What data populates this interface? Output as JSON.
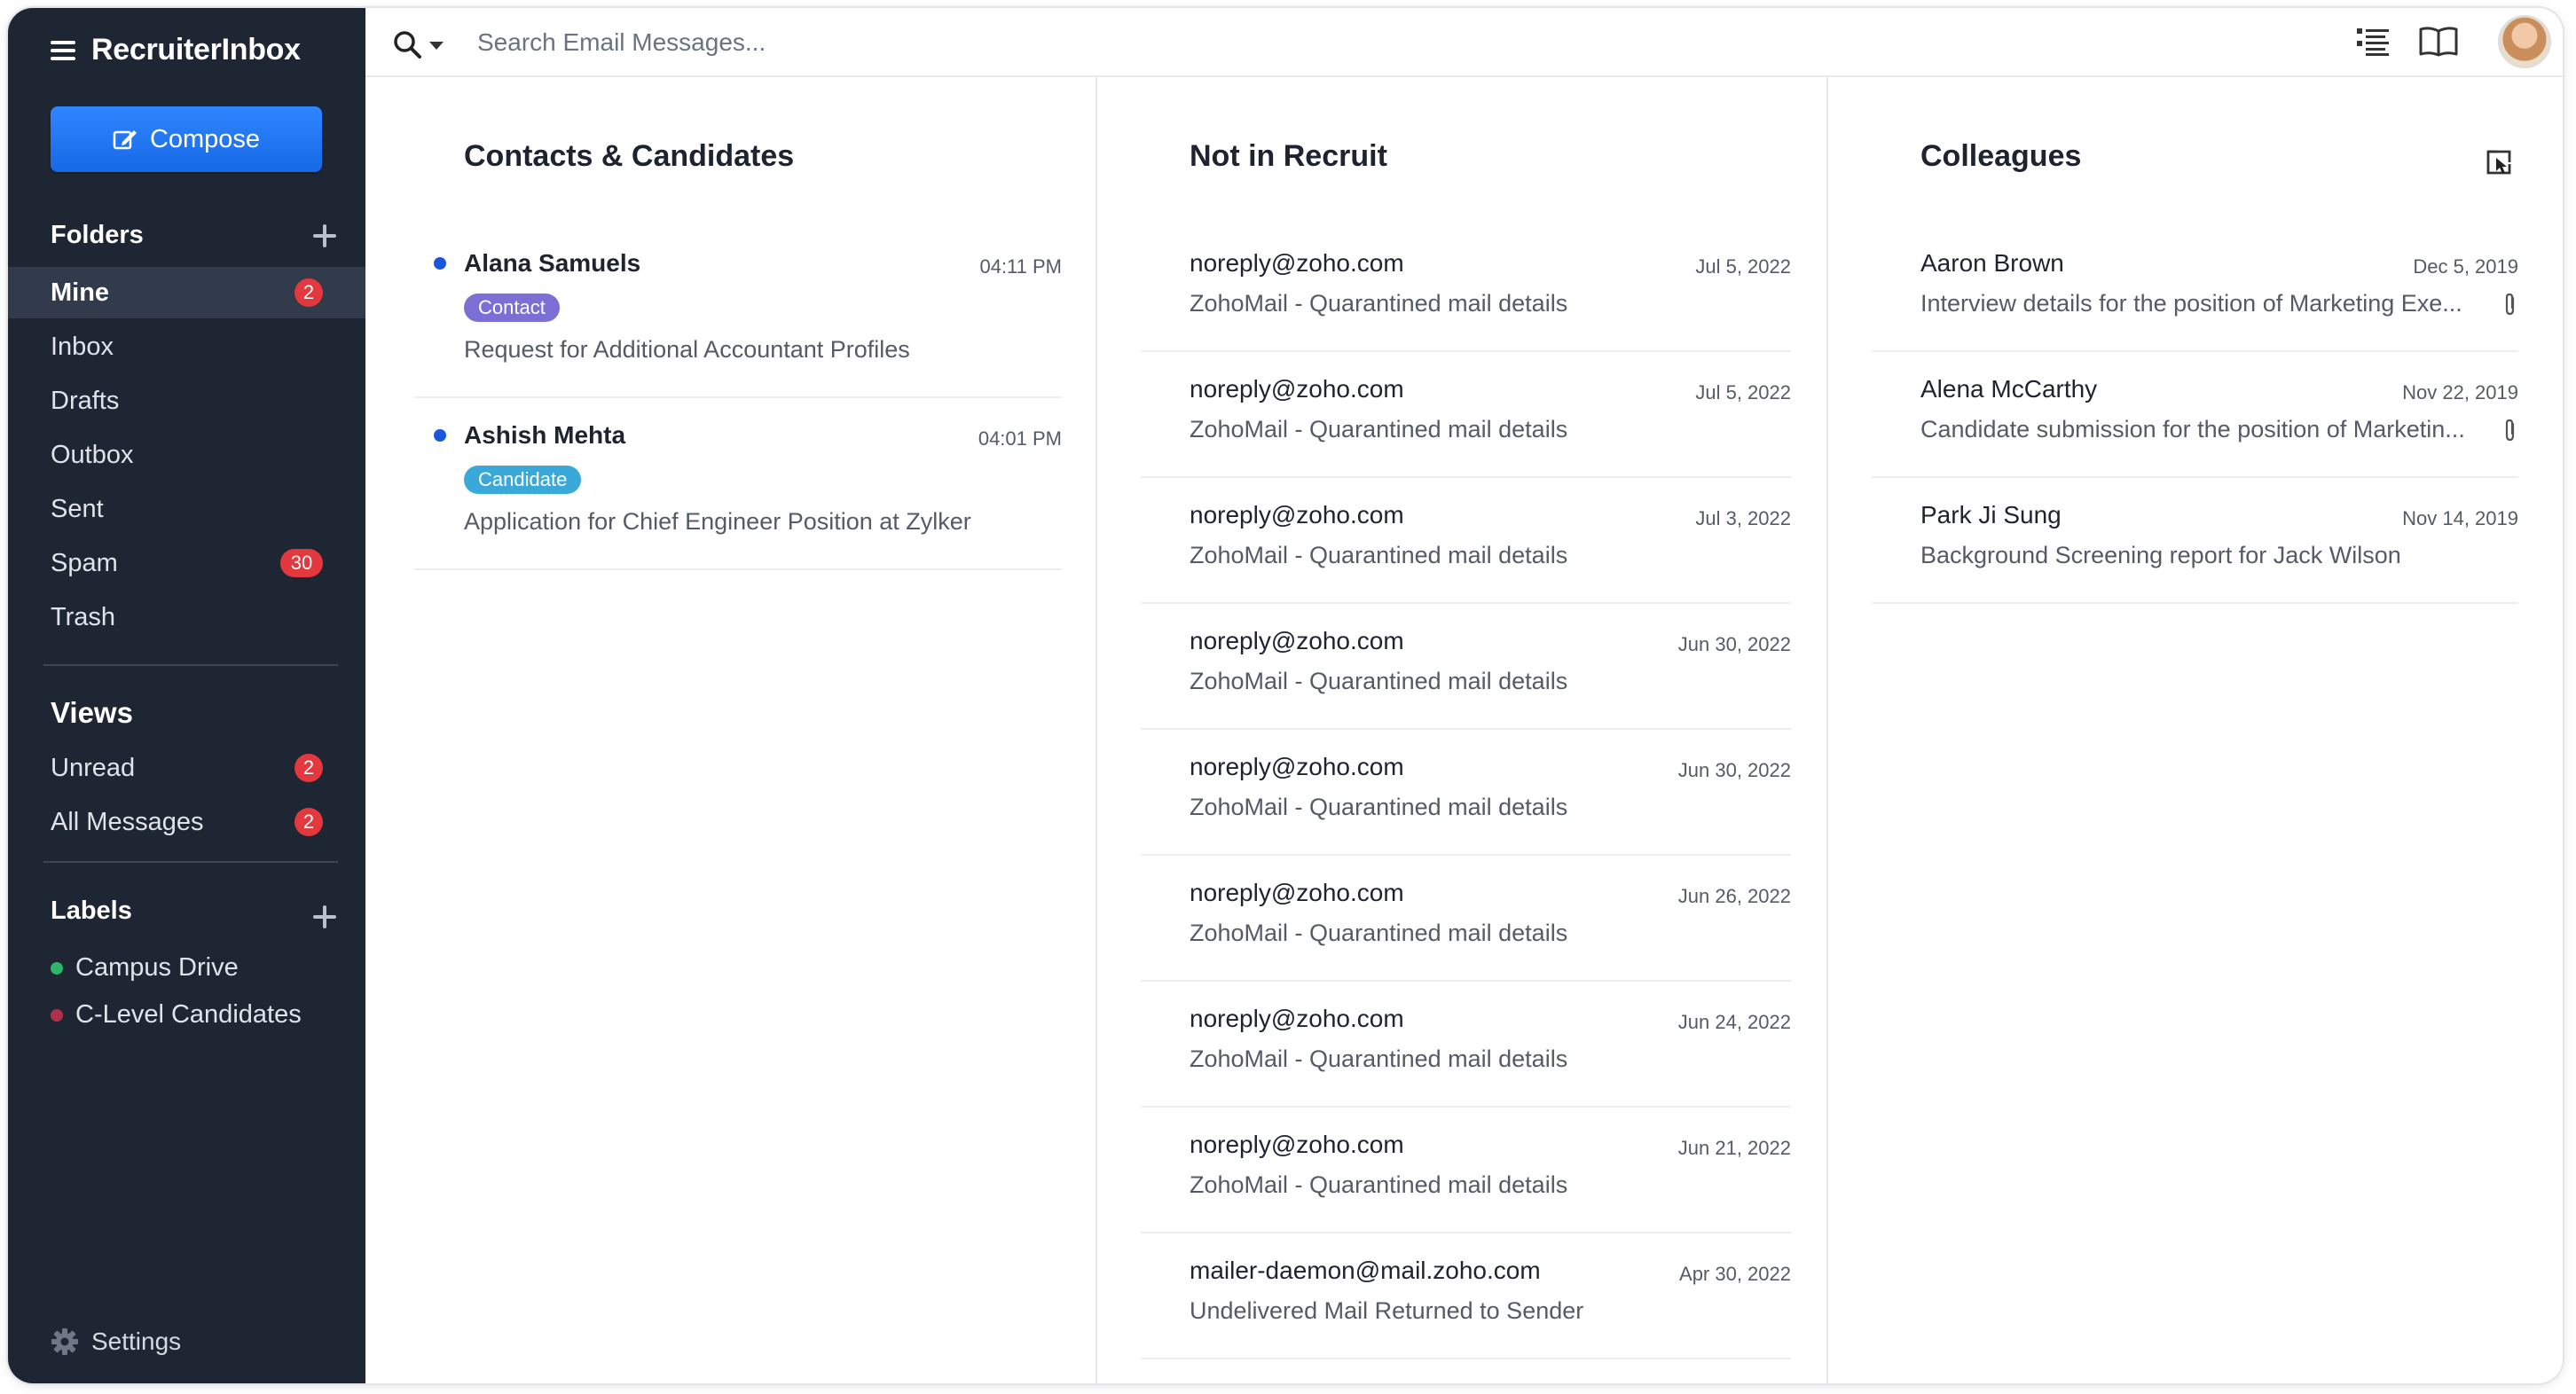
{
  "app": {
    "name": "RecruiterInbox"
  },
  "sidebar": {
    "compose_label": "Compose",
    "folders_title": "Folders",
    "folders": [
      {
        "label": "Mine",
        "badge": "2",
        "active": true
      },
      {
        "label": "Inbox",
        "badge": ""
      },
      {
        "label": "Drafts",
        "badge": ""
      },
      {
        "label": "Outbox",
        "badge": ""
      },
      {
        "label": "Sent",
        "badge": ""
      },
      {
        "label": "Spam",
        "badge": "30"
      },
      {
        "label": "Trash",
        "badge": ""
      }
    ],
    "views_title": "Views",
    "views": [
      {
        "label": "Unread",
        "badge": "2"
      },
      {
        "label": "All Messages",
        "badge": "2"
      }
    ],
    "labels_title": "Labels",
    "labels": [
      {
        "label": "Campus Drive",
        "color": "#2fb56a"
      },
      {
        "label": "C-Level Candidates",
        "color": "#b0324a"
      }
    ],
    "settings_label": "Settings"
  },
  "search": {
    "placeholder": "Search Email Messages..."
  },
  "columns": {
    "contacts": {
      "title": "Contacts & Candidates",
      "items": [
        {
          "from": "Alana Samuels",
          "time": "04:11 PM",
          "tag": "Contact",
          "tag_color": "#7b6fd6",
          "subject": "Request for Additional Accountant Profiles"
        },
        {
          "from": "Ashish Mehta",
          "time": "04:01 PM",
          "tag": "Candidate",
          "tag_color": "#3aa8d8",
          "subject": "Application for Chief Engineer Position at Zylker"
        }
      ]
    },
    "not_in_recruit": {
      "title": "Not in Recruit",
      "items": [
        {
          "from": "noreply@zoho.com",
          "date": "Jul 5, 2022",
          "subject": "ZohoMail - Quarantined mail details"
        },
        {
          "from": "noreply@zoho.com",
          "date": "Jul 5, 2022",
          "subject": "ZohoMail - Quarantined mail details"
        },
        {
          "from": "noreply@zoho.com",
          "date": "Jul 3, 2022",
          "subject": "ZohoMail - Quarantined mail details"
        },
        {
          "from": "noreply@zoho.com",
          "date": "Jun 30, 2022",
          "subject": "ZohoMail - Quarantined mail details"
        },
        {
          "from": "noreply@zoho.com",
          "date": "Jun 30, 2022",
          "subject": "ZohoMail - Quarantined mail details"
        },
        {
          "from": "noreply@zoho.com",
          "date": "Jun 26, 2022",
          "subject": "ZohoMail - Quarantined mail details"
        },
        {
          "from": "noreply@zoho.com",
          "date": "Jun 24, 2022",
          "subject": "ZohoMail - Quarantined mail details"
        },
        {
          "from": "noreply@zoho.com",
          "date": "Jun 21, 2022",
          "subject": "ZohoMail - Quarantined mail details"
        },
        {
          "from": "mailer-daemon@mail.zoho.com",
          "date": "Apr 30, 2022",
          "subject": "Undelivered Mail Returned to Sender"
        }
      ]
    },
    "colleagues": {
      "title": "Colleagues",
      "items": [
        {
          "from": "Aaron Brown",
          "date": "Dec 5, 2019",
          "subject": "Interview details for the position of Marketing Exe...",
          "attachment": true
        },
        {
          "from": "Alena McCarthy",
          "date": "Nov 22, 2019",
          "subject": "Candidate submission for the position of Marketin...",
          "attachment": true
        },
        {
          "from": "Park Ji Sung",
          "date": "Nov 14, 2019",
          "subject": "Background Screening report for Jack Wilson",
          "attachment": false
        }
      ]
    }
  },
  "colors": {
    "sidebar_bg": "#1f2633",
    "accent": "#1769e6",
    "badge": "#e4383f",
    "unread_dot": "#1a56db"
  }
}
